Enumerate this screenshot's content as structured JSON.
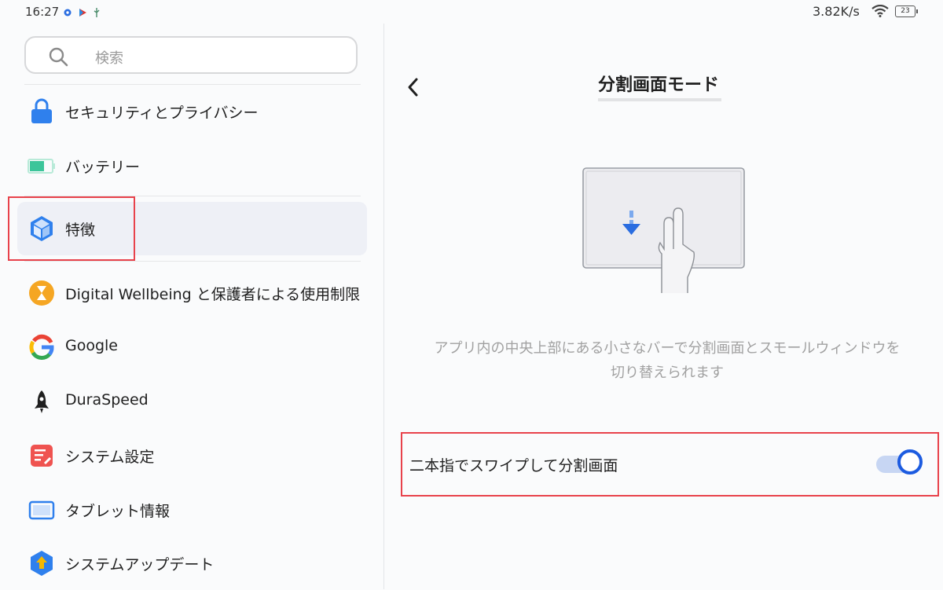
{
  "status_bar": {
    "time": "16:27",
    "icons": [
      "settings-gear-icon",
      "play-store-icon",
      "usb-debug-icon"
    ],
    "net_speed": "3.82K/s",
    "battery_level": "23"
  },
  "search": {
    "placeholder": "検索"
  },
  "menu": {
    "items": [
      {
        "label": "セキュリティとプライバシー",
        "icon": "lock-icon"
      },
      {
        "label": "バッテリー",
        "icon": "battery-icon"
      },
      {
        "label": "特徴",
        "icon": "cube-icon",
        "selected": true
      },
      {
        "label": "Digital Wellbeing と保護者による使用制限",
        "icon": "hourglass-icon"
      },
      {
        "label": "Google",
        "icon": "google-icon"
      },
      {
        "label": "DuraSpeed",
        "icon": "rocket-icon"
      },
      {
        "label": "システム設定",
        "icon": "system-settings-icon"
      },
      {
        "label": "タブレット情報",
        "icon": "tablet-icon"
      },
      {
        "label": "システムアップデート",
        "icon": "system-update-icon"
      }
    ]
  },
  "detail": {
    "title": "分割画面モード",
    "description": "アプリ内の中央上部にある小さなバーで分割画面とスモールウィンドウを切り替えられます",
    "toggle_label": "二本指でスワイプして分割画面",
    "toggle_on": true
  },
  "colors": {
    "accent": "#1c5be0",
    "highlight_box": "#e8424b",
    "selected_bg": "#eef0f6"
  }
}
